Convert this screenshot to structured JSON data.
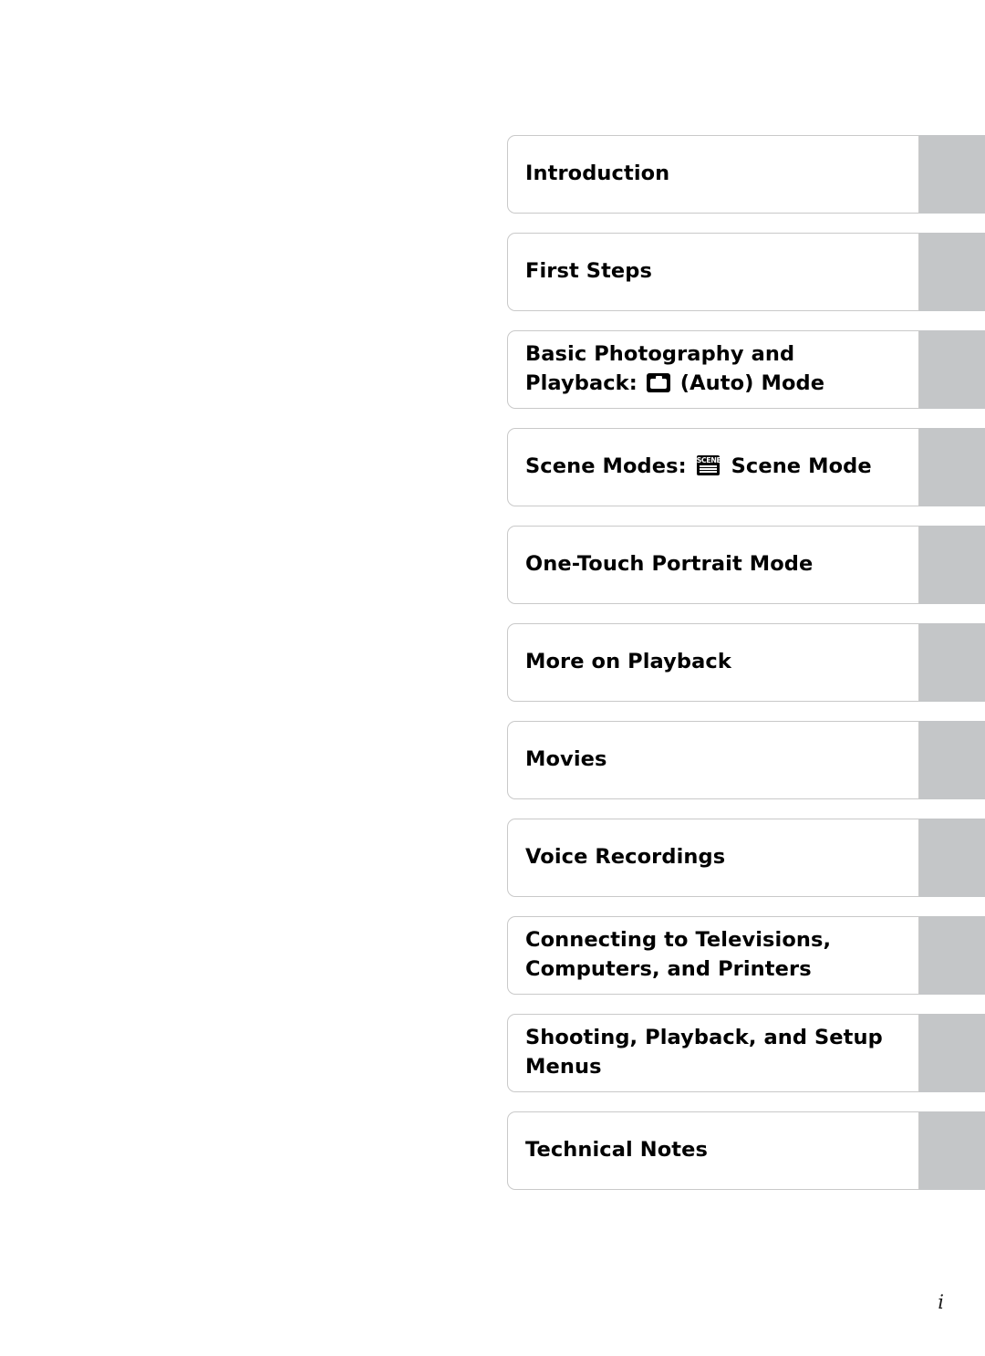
{
  "document": {
    "page_number": "i",
    "tabs": [
      {
        "label": "Introduction",
        "lines": [
          "Introduction"
        ],
        "icon": null
      },
      {
        "label": "First Steps",
        "lines": [
          "First Steps"
        ],
        "icon": null
      },
      {
        "label": "Basic Photography and Playback: (Auto) Mode",
        "lines": [
          "Basic Photography and",
          "Playback: "
        ],
        "line2_suffix": " (Auto) Mode",
        "icon": "camera-auto-mode-icon"
      },
      {
        "label": "Scene Modes: Scene Mode",
        "lines": [
          "Scene Modes: "
        ],
        "line1_suffix": " Scene Mode",
        "icon": "scene-mode-icon"
      },
      {
        "label": "One-Touch Portrait Mode",
        "lines": [
          "One-Touch Portrait Mode"
        ],
        "icon": null
      },
      {
        "label": "More on Playback",
        "lines": [
          "More on Playback"
        ],
        "icon": null
      },
      {
        "label": "Movies",
        "lines": [
          "Movies"
        ],
        "icon": null
      },
      {
        "label": "Voice Recordings",
        "lines": [
          "Voice Recordings"
        ],
        "icon": null
      },
      {
        "label": "Connecting to Televisions, Computers, and Printers",
        "lines": [
          "Connecting to Televisions,",
          "Computers, and Printers"
        ],
        "icon": null
      },
      {
        "label": "Shooting, Playback, and Setup Menus",
        "lines": [
          "Shooting, Playback, and Setup",
          "Menus"
        ],
        "icon": null
      },
      {
        "label": "Technical Notes",
        "lines": [
          "Technical Notes"
        ],
        "icon": null
      }
    ]
  },
  "colors": {
    "tab_thumb": "#c4c6c8",
    "tab_border": "#c9c9c9",
    "text": "#000000",
    "page_background": "#ffffff"
  }
}
